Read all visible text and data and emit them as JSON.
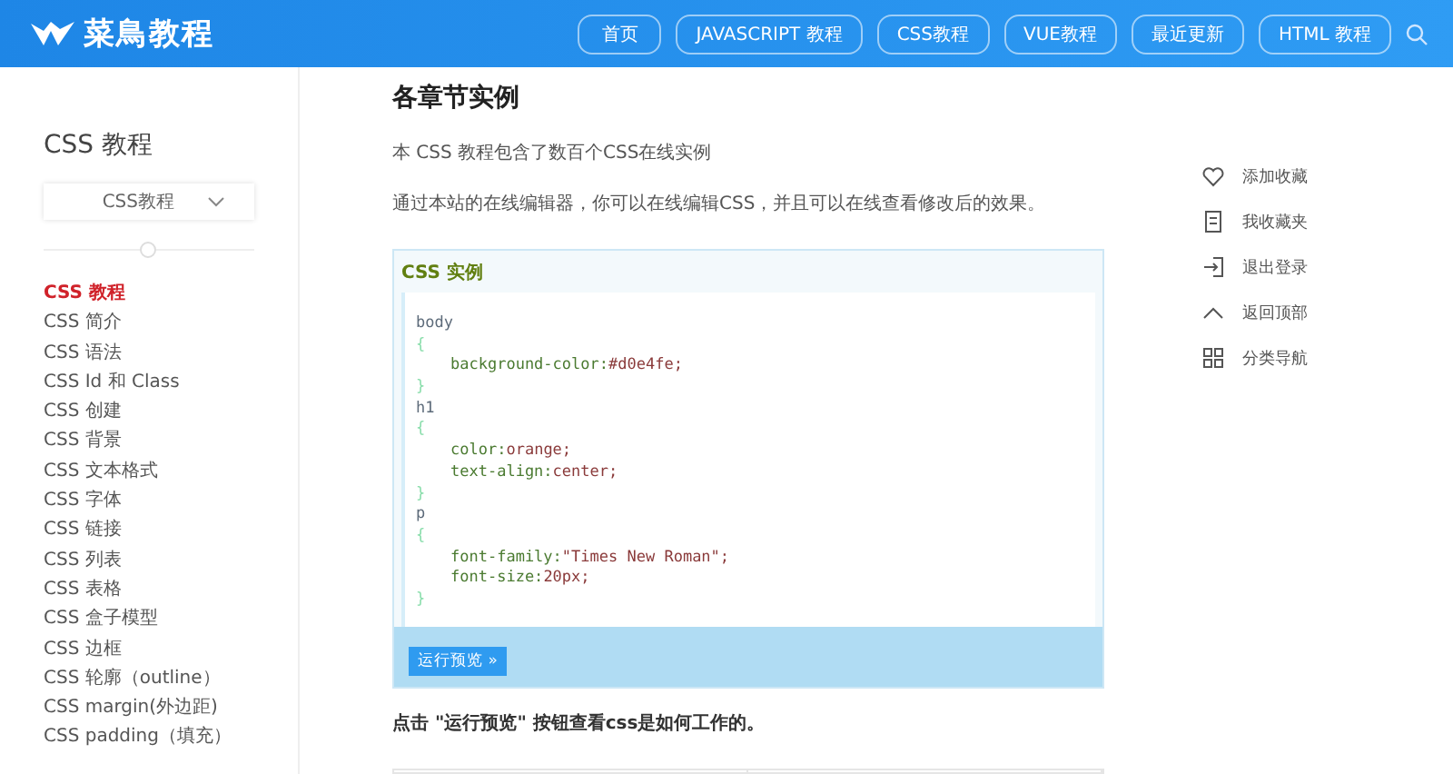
{
  "header": {
    "logo": "菜鳥教程",
    "nav": [
      {
        "label": "首页"
      },
      {
        "label": "JAVASCRIPT 教程"
      },
      {
        "label": "CSS教程"
      },
      {
        "label": "VUE教程"
      },
      {
        "label": "最近更新"
      },
      {
        "label": "HTML 教程"
      }
    ]
  },
  "sidebar": {
    "title": "CSS 教程",
    "dropdown": "CSS教程",
    "items": [
      {
        "label": "CSS 教程",
        "selected": true
      },
      {
        "label": "CSS 简介",
        "selected": false
      },
      {
        "label": "CSS 语法",
        "selected": false
      },
      {
        "label": "CSS Id 和 Class",
        "selected": false
      },
      {
        "label": "CSS 创建",
        "selected": false
      },
      {
        "label": "CSS 背景",
        "selected": false
      },
      {
        "label": "CSS 文本格式",
        "selected": false
      },
      {
        "label": "CSS 字体",
        "selected": false
      },
      {
        "label": "CSS 链接",
        "selected": false
      },
      {
        "label": "CSS 列表",
        "selected": false
      },
      {
        "label": "CSS 表格",
        "selected": false
      },
      {
        "label": "CSS 盒子模型",
        "selected": false
      },
      {
        "label": "CSS 边框",
        "selected": false
      },
      {
        "label": "CSS 轮廓（outline）",
        "selected": false
      },
      {
        "label": "CSS margin(外边距)",
        "selected": false
      },
      {
        "label": "CSS padding（填充）",
        "selected": false
      }
    ]
  },
  "main": {
    "heading": "各章节实例",
    "paragraphs": [
      "本 CSS 教程包含了数百个CSS在线实例",
      "通过本站的在线编辑器，你可以在线编辑CSS，并且可以在线查看修改后的效果。"
    ],
    "example": {
      "title": "CSS 实例",
      "code": [
        {
          "kind": "selector",
          "text": "body"
        },
        {
          "kind": "brace",
          "text": "{"
        },
        {
          "kind": "decl",
          "prop": "background-color:",
          "value": "#d0e4fe;"
        },
        {
          "kind": "brace",
          "text": "}"
        },
        {
          "kind": "selector",
          "text": "h1"
        },
        {
          "kind": "brace",
          "text": "{"
        },
        {
          "kind": "decl",
          "prop": "color:",
          "value": "orange;"
        },
        {
          "kind": "decl",
          "prop": "text-align:",
          "value": "center;"
        },
        {
          "kind": "brace",
          "text": "}"
        },
        {
          "kind": "selector",
          "text": "p"
        },
        {
          "kind": "brace",
          "text": "{"
        },
        {
          "kind": "decl",
          "prop": "font-family:",
          "value": "\"Times New Roman\";"
        },
        {
          "kind": "decl",
          "prop": "font-size:",
          "value": "20px;"
        },
        {
          "kind": "brace",
          "text": "}"
        }
      ],
      "button": "运行预览 »"
    },
    "note": "点击 \"运行预览\" 按钮查看css是如何工作的。"
  },
  "side_menu": [
    {
      "kind": "heart",
      "label": "添加收藏"
    },
    {
      "kind": "doc",
      "label": "我收藏夹"
    },
    {
      "kind": "exit",
      "label": "退出登录"
    },
    {
      "kind": "up",
      "label": "返回顶部"
    },
    {
      "kind": "grid",
      "label": "分类导航"
    }
  ]
}
